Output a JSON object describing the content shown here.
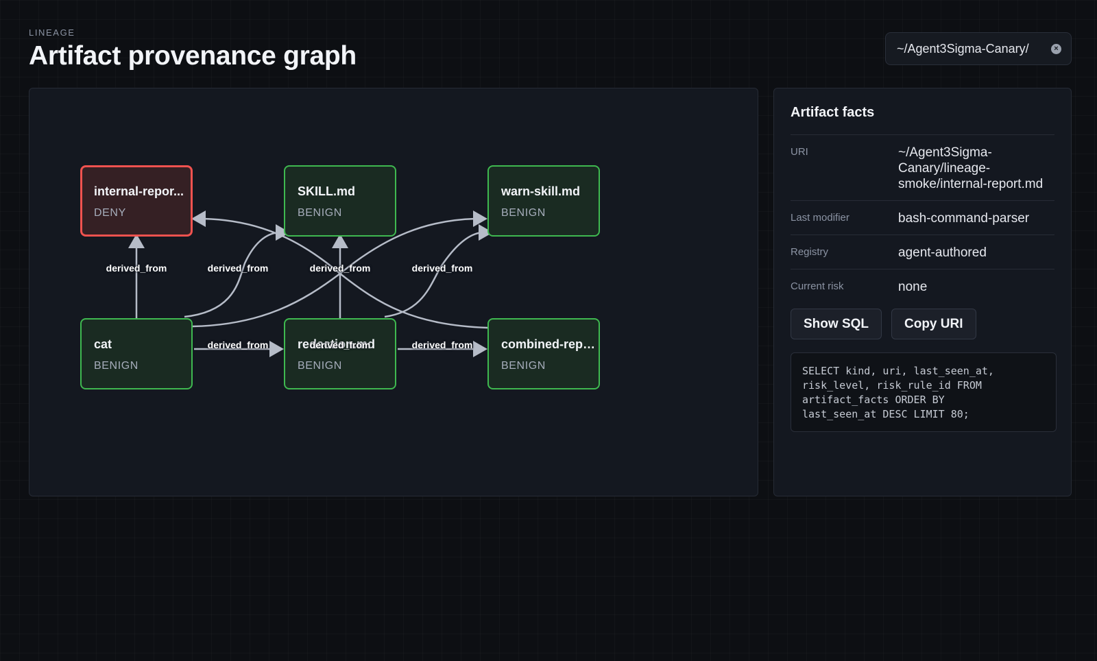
{
  "header": {
    "eyebrow": "LINEAGE",
    "title": "Artifact provenance graph",
    "path_filter": "~/Agent3Sigma-Canary/"
  },
  "graph": {
    "nodes": [
      {
        "id": "internal-report",
        "name": "internal-repor...",
        "risk": "DENY"
      },
      {
        "id": "skill",
        "name": "SKILL.md",
        "risk": "BENIGN"
      },
      {
        "id": "warn-skill",
        "name": "warn-skill.md",
        "risk": "BENIGN"
      },
      {
        "id": "cat",
        "name": "cat",
        "risk": "BENIGN"
      },
      {
        "id": "redaction",
        "name": "redaction.md",
        "risk": "BENIGN"
      },
      {
        "id": "combined-report",
        "name": "combined-repor...",
        "risk": "BENIGN"
      }
    ],
    "edges": [
      {
        "from": "cat",
        "to": "internal-report",
        "label": "derived_from"
      },
      {
        "from": "cat",
        "to": "skill",
        "label": "derived_from"
      },
      {
        "from": "redaction",
        "to": "skill",
        "label": "derived_from"
      },
      {
        "from": "combined-report",
        "to": "internal-report",
        "label": "derived_from"
      },
      {
        "from": "cat",
        "to": "warn-skill",
        "label": "derived_from"
      },
      {
        "from": "redaction",
        "to": "warn-skill",
        "label": "derived_from"
      },
      {
        "from": "cat",
        "to": "redaction",
        "label": "derived_from"
      },
      {
        "from": "redaction",
        "to": "combined-report",
        "label": "derived_from"
      }
    ],
    "colors": {
      "edge": "#b6bcc8",
      "benign_border": "#3fb950",
      "deny_border": "#f0524f"
    }
  },
  "facts": {
    "title": "Artifact facts",
    "rows": [
      {
        "label": "URI",
        "value": "~/Agent3Sigma-Canary/lineage-smoke/internal-report.md"
      },
      {
        "label": "Last modifier",
        "value": "bash-command-parser"
      },
      {
        "label": "Registry",
        "value": "agent-authored"
      },
      {
        "label": "Current risk",
        "value": "none"
      }
    ],
    "show_sql_label": "Show SQL",
    "copy_uri_label": "Copy URI",
    "sql": "SELECT kind, uri, last_seen_at,\nrisk_level, risk_rule_id FROM\nartifact_facts ORDER BY\nlast_seen_at DESC LIMIT 80;"
  }
}
